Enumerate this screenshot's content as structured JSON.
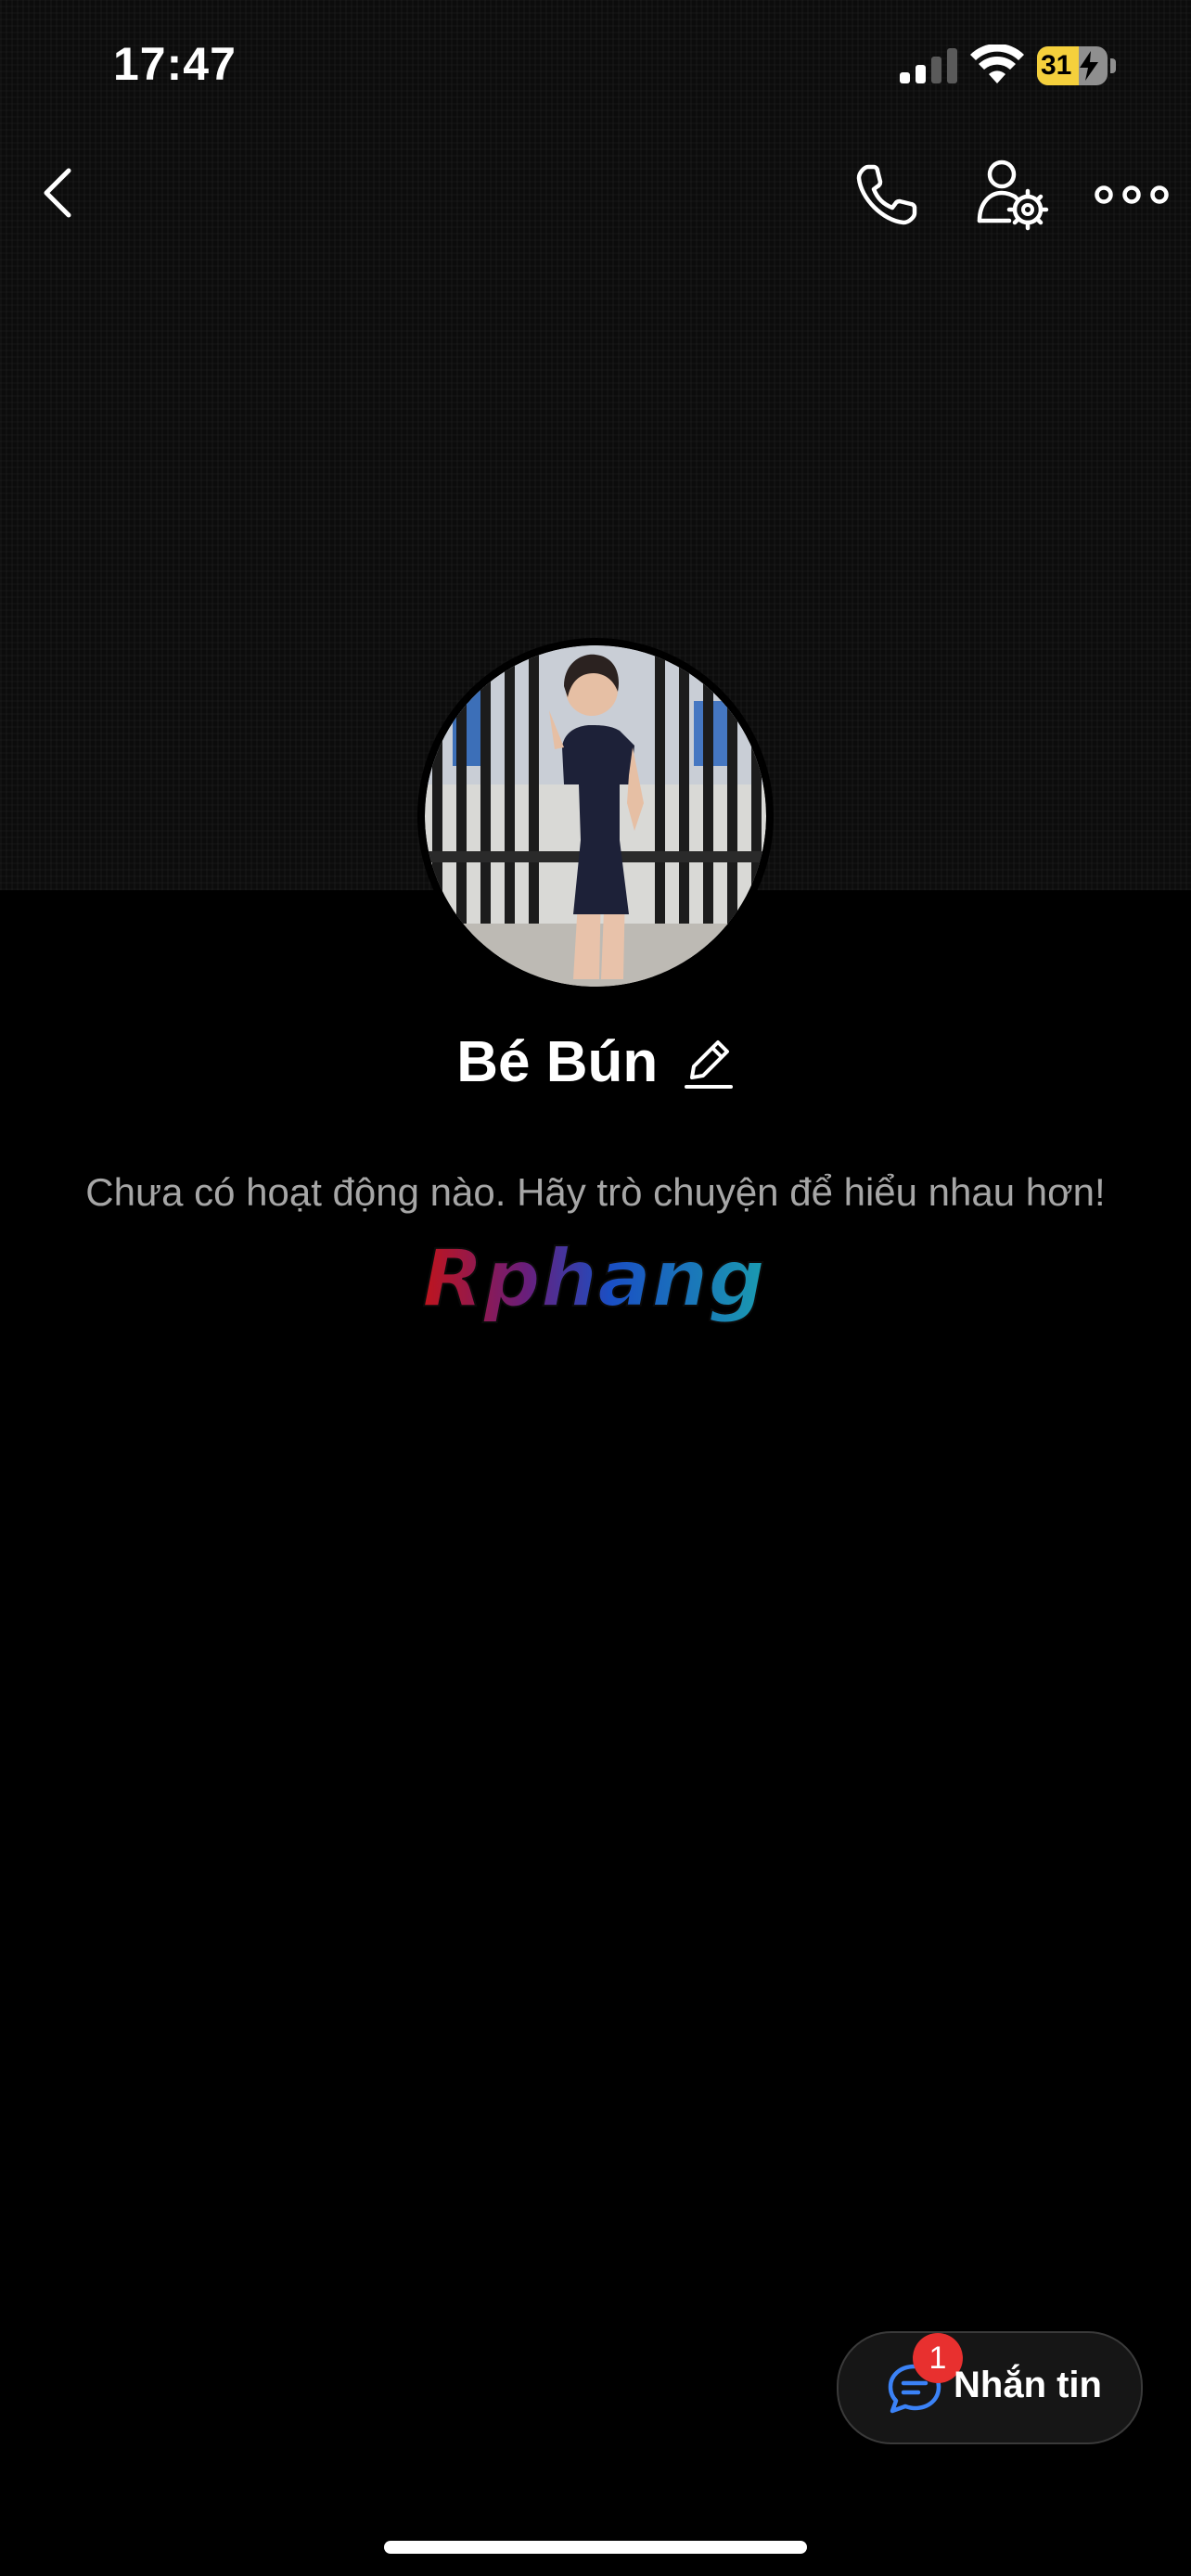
{
  "status_bar": {
    "time": "17:47",
    "battery_level": "31",
    "battery_fraction": 0.31,
    "battery_color": "#f5d03c",
    "signal_bars_active": 2,
    "icons": [
      "signal-icon",
      "wifi-icon",
      "battery-charging-icon"
    ]
  },
  "nav": {
    "icons": [
      "back-chevron-icon",
      "phone-call-icon",
      "profile-settings-icon",
      "more-dots-icon"
    ]
  },
  "profile": {
    "name": "Bé Bún",
    "edit_icon": "pencil-icon",
    "empty_activity": "Chưa có hoạt động nào. Hãy trò chuyện để hiểu nhau hơn!"
  },
  "watermark": {
    "text": "Rphang",
    "colors": [
      "#c0141c",
      "#1a4fc4",
      "#1a9bb0"
    ]
  },
  "message_button": {
    "label": "Nhắn tin",
    "badge_count": "1",
    "icon": "chat-bubble-icon",
    "badge_color": "#e8302f",
    "icon_color": "#3b82f6"
  }
}
